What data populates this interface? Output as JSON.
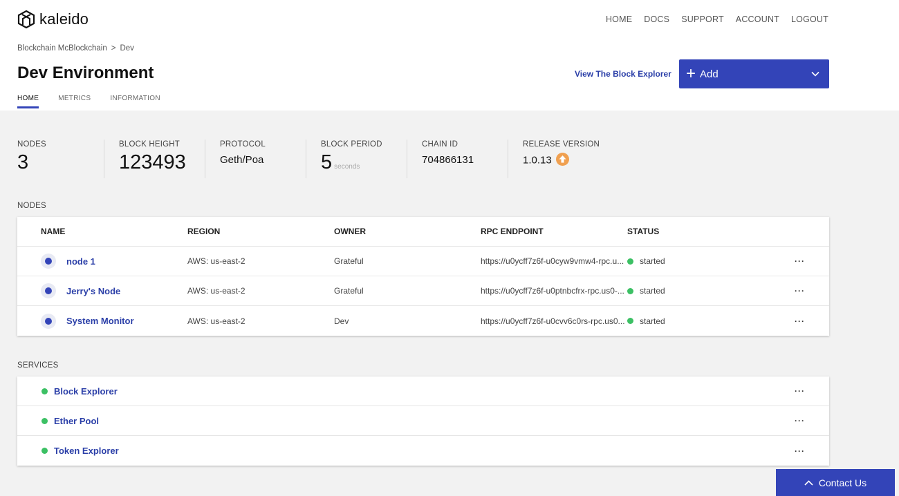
{
  "brand": {
    "name": "kaleido"
  },
  "topnav": [
    "HOME",
    "DOCS",
    "SUPPORT",
    "ACCOUNT",
    "LOGOUT"
  ],
  "breadcrumb": {
    "parent": "Blockchain McBlockchain",
    "separator": ">",
    "current": "Dev"
  },
  "page": {
    "title": "Dev Environment"
  },
  "actions": {
    "explorer_link": "View The Block Explorer",
    "add_label": "Add"
  },
  "tabs": [
    "HOME",
    "METRICS",
    "INFORMATION"
  ],
  "stats": {
    "nodes": {
      "label": "NODES",
      "value": "3"
    },
    "block_height": {
      "label": "BLOCK HEIGHT",
      "value": "123493"
    },
    "protocol": {
      "label": "PROTOCOL",
      "value": "Geth/Poa"
    },
    "block_period": {
      "label": "BLOCK PERIOD",
      "value": "5",
      "unit": "seconds"
    },
    "chain_id": {
      "label": "CHAIN ID",
      "value": "704866131"
    },
    "release_version": {
      "label": "RELEASE VERSION",
      "value": "1.0.13"
    }
  },
  "nodes_section": {
    "label": "NODES",
    "headers": {
      "name": "NAME",
      "region": "REGION",
      "owner": "OWNER",
      "rpc": "RPC ENDPOINT",
      "status": "STATUS"
    },
    "rows": [
      {
        "name": "node 1",
        "region": "AWS: us-east-2",
        "owner": "Grateful",
        "rpc": "https://u0ycff7z6f-u0cyw9vmw4-rpc.u...",
        "status": "started"
      },
      {
        "name": "Jerry's Node",
        "region": "AWS: us-east-2",
        "owner": "Grateful",
        "rpc": "https://u0ycff7z6f-u0ptnbcfrx-rpc.us0-...",
        "status": "started"
      },
      {
        "name": "System Monitor",
        "region": "AWS: us-east-2",
        "owner": "Dev",
        "rpc": "https://u0ycff7z6f-u0cvv6c0rs-rpc.us0...",
        "status": "started"
      }
    ],
    "more": "···"
  },
  "services_section": {
    "label": "SERVICES",
    "rows": [
      {
        "name": "Block Explorer"
      },
      {
        "name": "Ether Pool"
      },
      {
        "name": "Token Explorer"
      }
    ],
    "more": "···"
  },
  "contact": {
    "label": "Contact Us"
  },
  "colors": {
    "accent": "#3344b8",
    "link": "#2b3fa8",
    "status_ok": "#3cc064",
    "upgrade": "#f0a050",
    "background": "#f2f2f2"
  }
}
